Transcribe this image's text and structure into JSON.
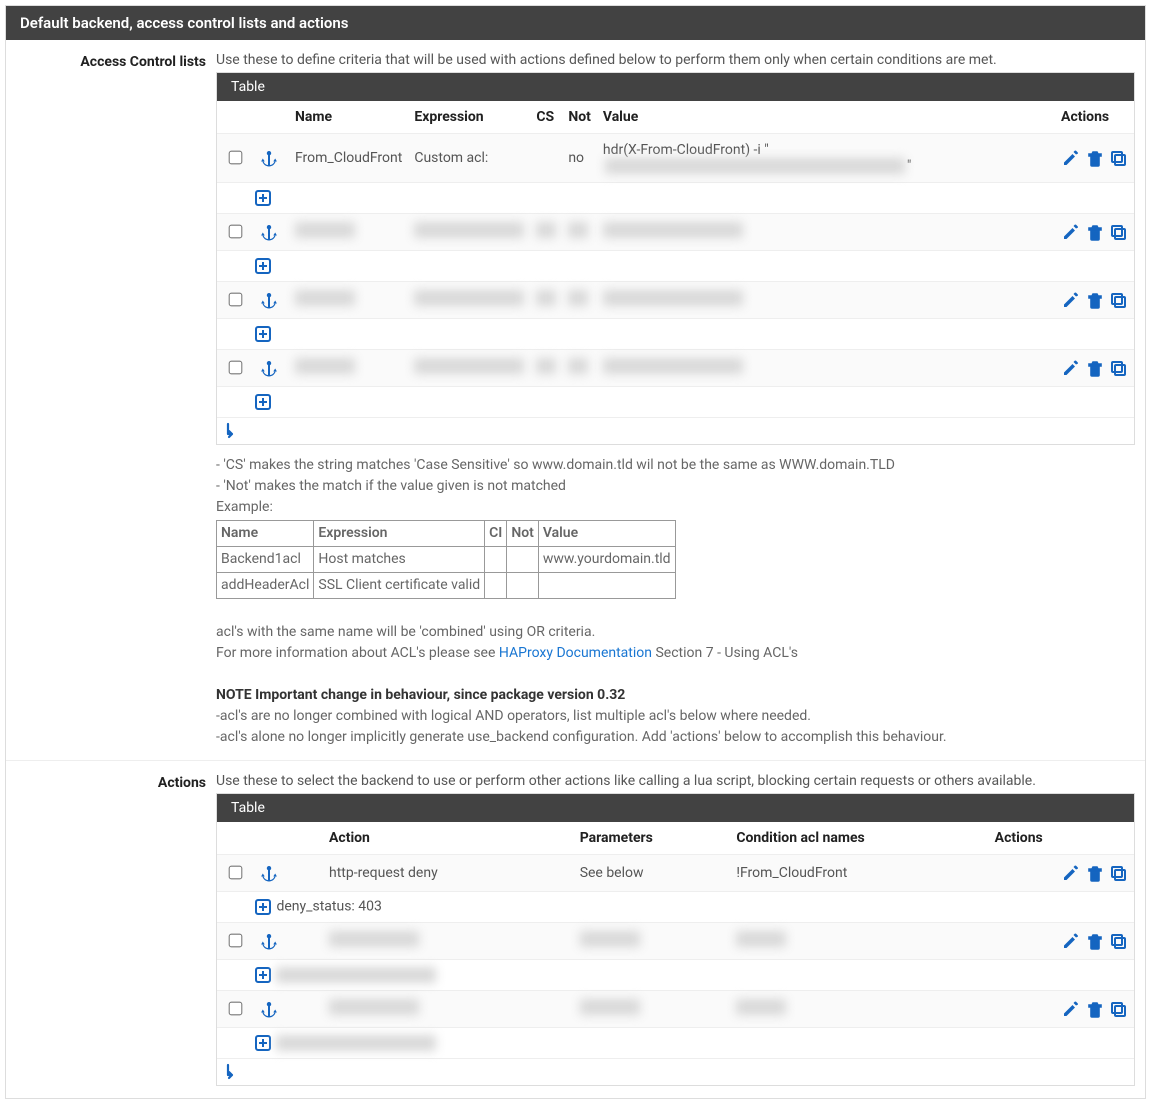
{
  "panel_title": "Default backend, access control lists and actions",
  "acl": {
    "label": "Access Control lists",
    "desc": "Use these to define criteria that will be used with actions defined below to perform them only when certain conditions are met.",
    "table_title": "Table",
    "headers": {
      "name": "Name",
      "expression": "Expression",
      "cs": "CS",
      "not": "Not",
      "value": "Value",
      "actions": "Actions"
    },
    "rows": [
      {
        "name": "From_CloudFront",
        "expression": "Custom acl:",
        "cs": "",
        "not": "no",
        "value": "hdr(X-From-CloudFront) -i \"",
        "redacted": false,
        "value_tail_redacted": true
      },
      {
        "redacted": true
      },
      {
        "redacted": true
      },
      {
        "redacted": true
      }
    ],
    "help": {
      "line1": "- 'CS' makes the string matches 'Case Sensitive' so www.domain.tld wil not be the same as WWW.domain.TLD",
      "line2": "- 'Not' makes the match if the value given is not matched",
      "example_label": "Example:",
      "example_headers": {
        "name": "Name",
        "expression": "Expression",
        "ci": "CI",
        "not": "Not",
        "value": "Value"
      },
      "example_rows": [
        {
          "name": "Backend1acl",
          "expression": "Host matches",
          "ci": "",
          "not": "",
          "value": "www.yourdomain.tld"
        },
        {
          "name": "addHeaderAcl",
          "expression": "SSL Client certificate valid",
          "ci": "",
          "not": "",
          "value": ""
        }
      ],
      "combine": "acl's with the same name will be 'combined' using OR criteria.",
      "moreinfo_pre": "For more information about ACL's please see ",
      "moreinfo_link": "HAProxy Documentation",
      "moreinfo_post": " Section 7 - Using ACL's",
      "note_title": "NOTE Important change in behaviour, since package version 0.32",
      "note1": "-acl's are no longer combined with logical AND operators, list multiple acl's below where needed.",
      "note2": "-acl's alone no longer implicitly generate use_backend configuration. Add 'actions' below to accomplish this behaviour."
    }
  },
  "actions": {
    "label": "Actions",
    "desc": "Use these to select the backend to use or perform other actions like calling a lua script, blocking certain requests or others available.",
    "table_title": "Table",
    "headers": {
      "action": "Action",
      "parameters": "Parameters",
      "condition": "Condition acl names",
      "actions": "Actions"
    },
    "rows": [
      {
        "action": "http-request deny",
        "parameters": "See below",
        "condition": "!From_CloudFront",
        "sub": "deny_status: 403",
        "redacted": false
      },
      {
        "redacted": true
      },
      {
        "redacted": true
      }
    ]
  }
}
